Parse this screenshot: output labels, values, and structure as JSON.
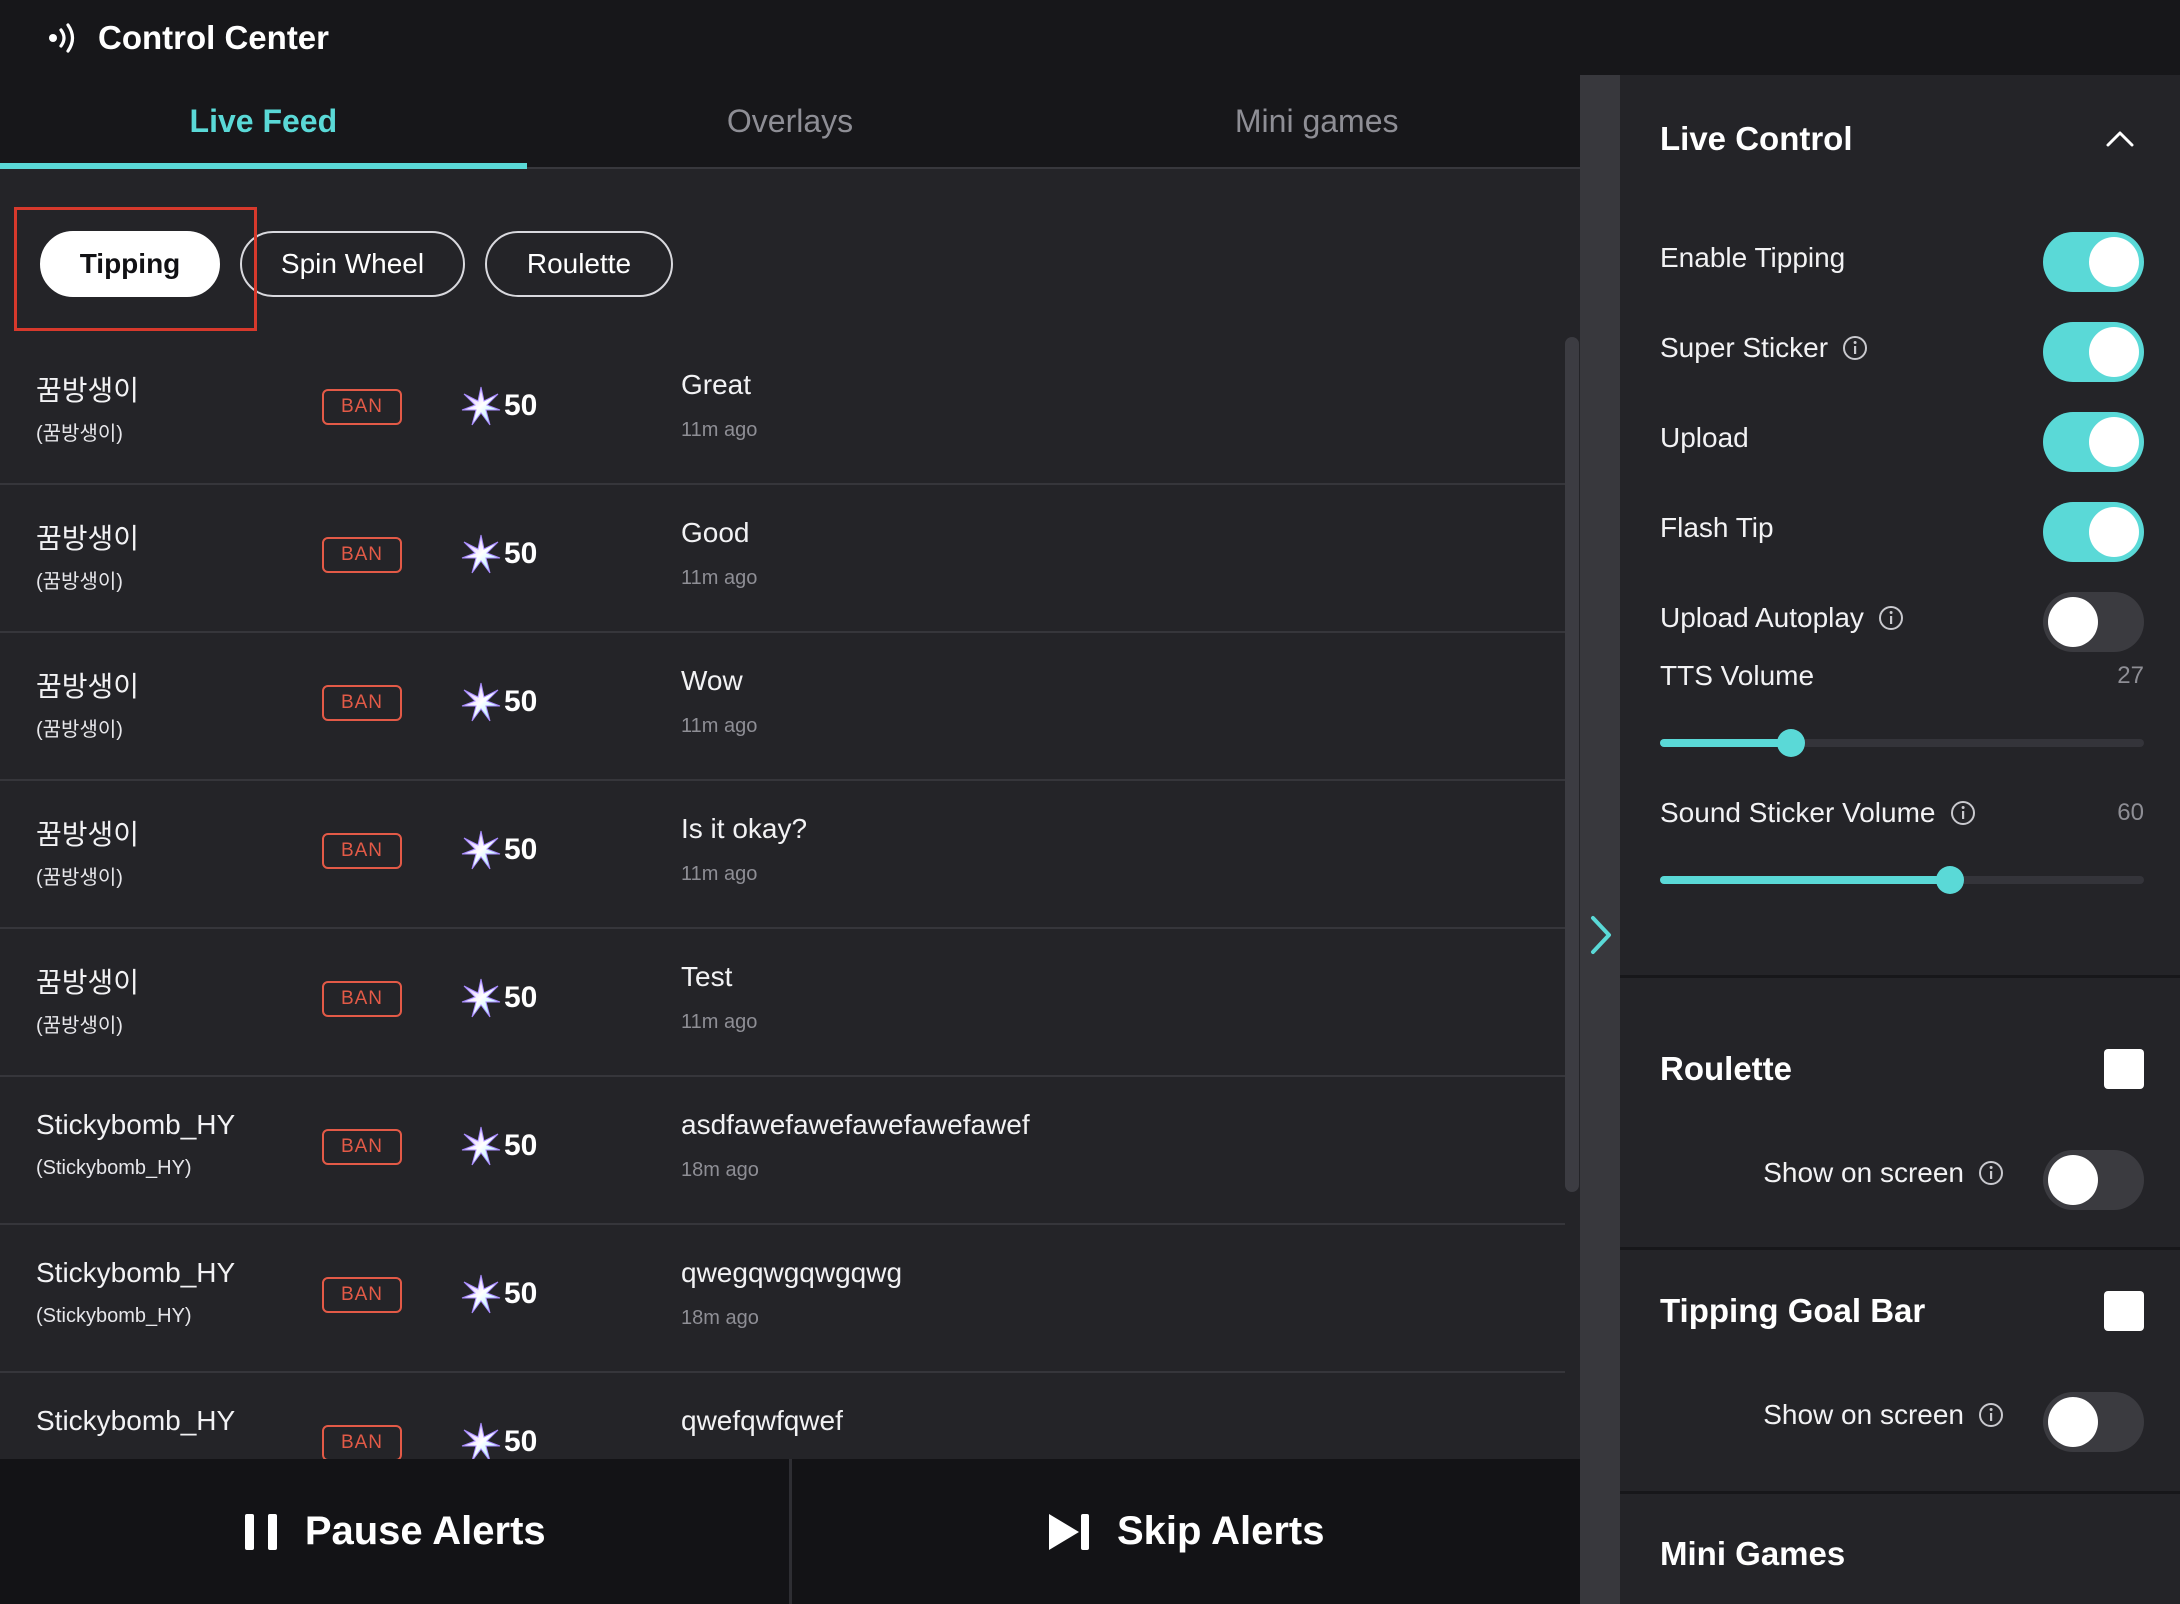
{
  "app": {
    "title": "Control Center",
    "icon": "broadcast-icon"
  },
  "tabs": [
    {
      "label": "Live Feed",
      "active": true
    },
    {
      "label": "Overlays",
      "active": false
    },
    {
      "label": "Mini games",
      "active": false
    }
  ],
  "filter_chips": [
    {
      "label": "Tipping",
      "selected": true
    },
    {
      "label": "Spin Wheel",
      "selected": false
    },
    {
      "label": "Roulette",
      "selected": false
    }
  ],
  "feed": {
    "ban_label": "BAN",
    "amount_icon": "sparkle-star-icon",
    "rows": [
      {
        "user_name": "꿈방생이",
        "user_id": "(꿈방생이)",
        "amount": "50",
        "message": "Great",
        "time": "11m ago"
      },
      {
        "user_name": "꿈방생이",
        "user_id": "(꿈방생이)",
        "amount": "50",
        "message": "Good",
        "time": "11m ago"
      },
      {
        "user_name": "꿈방생이",
        "user_id": "(꿈방생이)",
        "amount": "50",
        "message": "Wow",
        "time": "11m ago"
      },
      {
        "user_name": "꿈방생이",
        "user_id": "(꿈방생이)",
        "amount": "50",
        "message": "Is it okay?",
        "time": "11m ago"
      },
      {
        "user_name": "꿈방생이",
        "user_id": "(꿈방생이)",
        "amount": "50",
        "message": "Test",
        "time": "11m ago"
      },
      {
        "user_name": "Stickybomb_HY",
        "user_id": "(Stickybomb_HY)",
        "amount": "50",
        "message": "asdfawefawefawefawefawef",
        "time": "18m ago"
      },
      {
        "user_name": "Stickybomb_HY",
        "user_id": "(Stickybomb_HY)",
        "amount": "50",
        "message": "qwegqwgqwgqwg",
        "time": "18m ago"
      },
      {
        "user_name": "Stickybomb_HY",
        "user_id": "",
        "amount": "50",
        "message": "qwefqwfqwef",
        "time": ""
      }
    ]
  },
  "bottom_bar": {
    "pause_label": "Pause Alerts",
    "skip_label": "Skip Alerts"
  },
  "live_control": {
    "title": "Live Control",
    "toggles": [
      {
        "label": "Enable Tipping",
        "on": true,
        "info": false
      },
      {
        "label": "Super Sticker",
        "on": true,
        "info": true
      },
      {
        "label": "Upload",
        "on": true,
        "info": false
      },
      {
        "label": "Flash Tip",
        "on": true,
        "info": false
      },
      {
        "label": "Upload Autoplay",
        "on": false,
        "info": true
      }
    ],
    "sliders": [
      {
        "label": "TTS Volume",
        "value": "27",
        "fraction": 0.27,
        "info": false
      },
      {
        "label": "Sound Sticker Volume",
        "value": "60",
        "fraction": 0.6,
        "info": true
      }
    ]
  },
  "roulette": {
    "title": "Roulette",
    "show_label": "Show on screen",
    "show_on": false
  },
  "tipping_goal_bar": {
    "title": "Tipping Goal Bar",
    "show_label": "Show on screen",
    "show_on": false
  },
  "mini_games": {
    "title": "Mini Games"
  },
  "colors": {
    "accent": "#5ad9d7",
    "ban": "#e35a47",
    "highlight": "#d7392c"
  }
}
